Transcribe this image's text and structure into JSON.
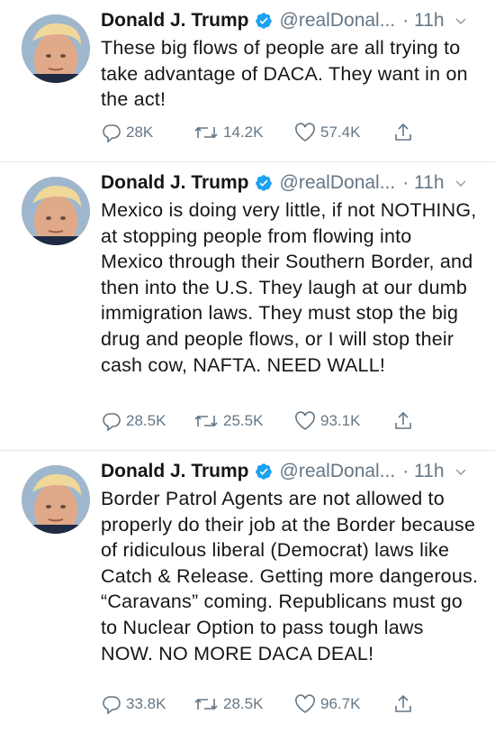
{
  "tweets": [
    {
      "name": "Donald J. Trump",
      "handle": "@realDonal...",
      "time": "· 11h",
      "text": "These big flows of people are all trying to take advantage of DACA. They want in on the act!",
      "replies": "28K",
      "retweets": "14.2K",
      "likes": "57.4K"
    },
    {
      "name": "Donald J. Trump",
      "handle": "@realDonal...",
      "time": "· 11h",
      "text": "Mexico is doing very little, if not NOTHING, at stopping people from flowing into Mexico through their Southern Border, and then into the U.S. They laugh at our dumb immigration laws. They must stop the big drug and people flows, or I will stop their cash cow, NAFTA. NEED WALL!",
      "replies": "28.5K",
      "retweets": "25.5K",
      "likes": "93.1K"
    },
    {
      "name": "Donald J. Trump",
      "handle": "@realDonal...",
      "time": "· 11h",
      "text": "Border Patrol Agents are not allowed to properly do their job at the Border because of ridiculous liberal (Democrat) laws like Catch & Release. Getting more dangerous. “Caravans” coming. Republicans must go to Nuclear Option to pass tough laws NOW. NO MORE DACA DEAL!",
      "replies": "33.8K",
      "retweets": "28.5K",
      "likes": "96.7K"
    }
  ],
  "colors": {
    "text": "#14171a",
    "secondary": "#657786",
    "verified": "#1da1f2",
    "divider": "#e1e8ed"
  },
  "icons": [
    "avatar",
    "verified-badge-icon",
    "chevron-down-icon",
    "reply-icon",
    "retweet-icon",
    "like-icon",
    "share-icon"
  ]
}
